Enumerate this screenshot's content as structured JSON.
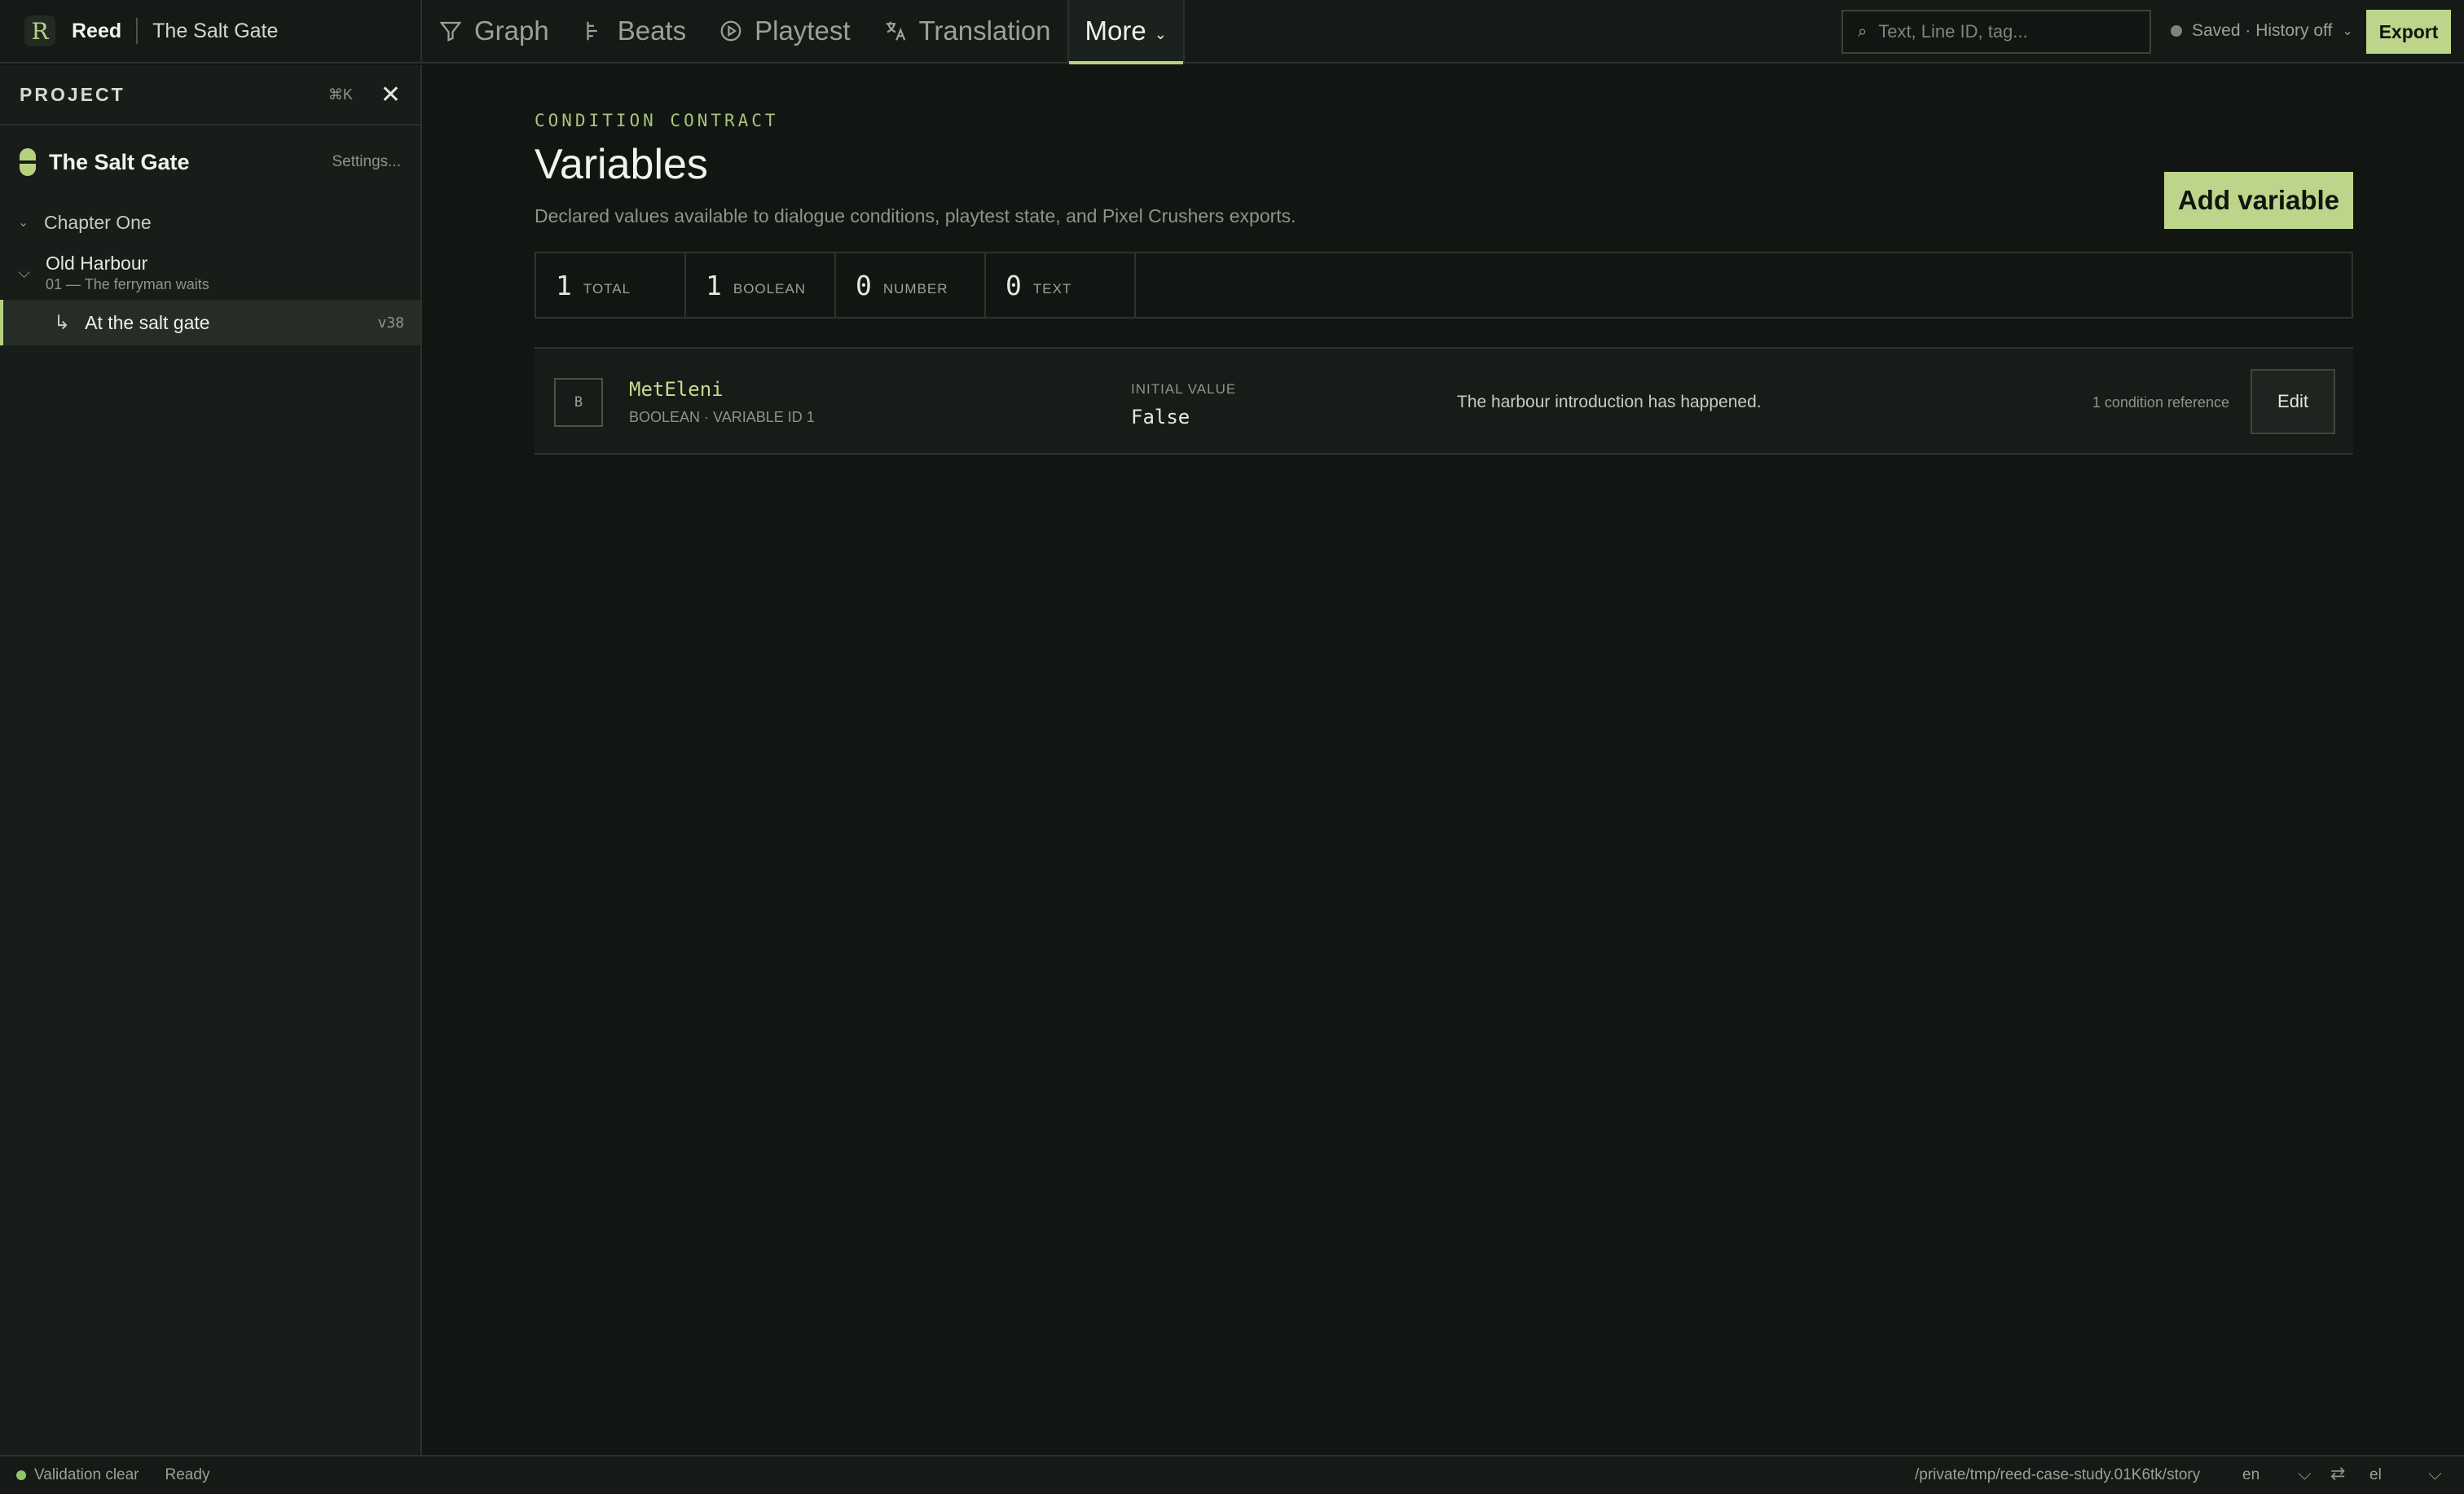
{
  "app": {
    "logo": "R",
    "name": "Reed",
    "project": "The Salt Gate"
  },
  "nav": {
    "tabs": [
      {
        "label": "Graph",
        "icon": "funnel-icon"
      },
      {
        "label": "Beats",
        "icon": "beats-icon"
      },
      {
        "label": "Playtest",
        "icon": "play-circle-icon"
      },
      {
        "label": "Translation",
        "icon": "translate-icon"
      },
      {
        "label": "More",
        "icon": "chevron-down-icon",
        "active": true
      }
    ]
  },
  "search": {
    "placeholder": "Text, Line ID, tag..."
  },
  "save_status": "Saved · History off",
  "export_label": "Export",
  "sidebar": {
    "title": "PROJECT",
    "shortcut": "⌘K",
    "close_glyph": "✕",
    "project_name": "The Salt Gate",
    "settings_label": "Settings...",
    "chapter": "Chapter One",
    "scene": {
      "label": "Old Harbour",
      "subtitle": "01 — The ferryman waits"
    },
    "node": {
      "label": "At the salt gate",
      "version": "v38"
    }
  },
  "main": {
    "eyebrow": "CONDITION CONTRACT",
    "title": "Variables",
    "description": "Declared values available to dialogue conditions, playtest state, and Pixel Crushers exports.",
    "add_button": "Add variable",
    "stats": [
      {
        "value": "1",
        "label": "TOTAL"
      },
      {
        "value": "1",
        "label": "BOOLEAN"
      },
      {
        "value": "0",
        "label": "NUMBER"
      },
      {
        "value": "0",
        "label": "TEXT"
      }
    ],
    "variables": [
      {
        "type_badge": "B",
        "name": "MetEleni",
        "meta": "BOOLEAN · VARIABLE ID 1",
        "initial_label": "INITIAL VALUE",
        "initial_value": "False",
        "description": "The harbour introduction has happened.",
        "references": "1 condition reference",
        "edit_label": "Edit"
      }
    ]
  },
  "statusbar": {
    "validation": "Validation clear",
    "state": "Ready",
    "path": "/private/tmp/reed-case-study.01K6tk/story",
    "source_lang": "en",
    "swap_glyph": "⇄",
    "target_lang": "el"
  },
  "colors": {
    "accent": "#bcd58a",
    "background": "#121613",
    "panel": "#181d19"
  }
}
